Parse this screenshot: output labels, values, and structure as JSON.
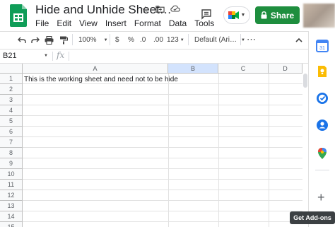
{
  "header": {
    "title": "Hide and Unhide Sheet…",
    "menu": [
      "File",
      "Edit",
      "View",
      "Insert",
      "Format",
      "Data",
      "Tools"
    ],
    "share_label": "Share"
  },
  "toolbar": {
    "zoom": "100%",
    "currency": "$",
    "percent": "%",
    "decrease_decimal": ".0",
    "increase_decimal": ".00",
    "number_format": "123",
    "font": "Default (Ari…"
  },
  "formula_bar": {
    "name_box": "B21",
    "fx": "fx"
  },
  "sheet": {
    "columns": [
      "A",
      "B",
      "C",
      "D"
    ],
    "rows": [
      "1",
      "2",
      "3",
      "4",
      "5",
      "6",
      "7",
      "8",
      "9",
      "10",
      "11",
      "12",
      "13",
      "14",
      "15"
    ],
    "cell_a1": "This is the working sheet and need not to be hide"
  },
  "sidebar": {
    "calendar_date": "31",
    "tooltip": "Get Add-ons"
  },
  "colors": {
    "share": "#1e8e3e",
    "sheets_green": "#0f9d58"
  }
}
